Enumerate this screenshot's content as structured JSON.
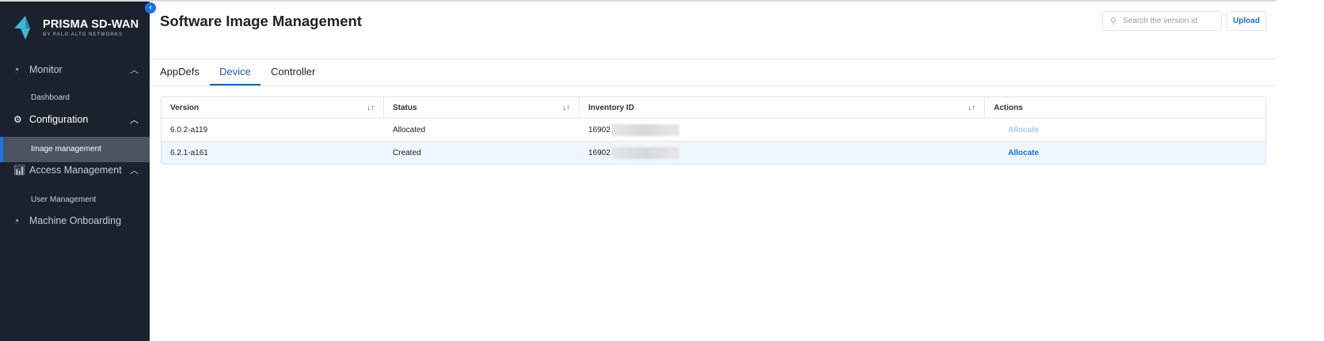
{
  "sidebar": {
    "logo": {
      "title": "PRISMA SD-WAN",
      "subtitle": "BY PALO ALTO NETWORKS"
    },
    "sections": [
      {
        "label": "Monitor",
        "icon": "dashboard-gauge-icon",
        "items": [
          {
            "label": "Dashboard"
          }
        ]
      },
      {
        "label": "Configuration",
        "icon": "gear-icon",
        "items": [
          {
            "label": "Image management",
            "active": true
          }
        ]
      },
      {
        "label": "Access Management",
        "icon": "bar-chart-icon",
        "items": [
          {
            "label": "User Management"
          }
        ]
      },
      {
        "label": "Machine Onboarding",
        "icon": "dashboard-gauge-icon",
        "items": []
      }
    ]
  },
  "header": {
    "title": "Software Image Management",
    "search_placeholder": "Search the version id",
    "upload_label": "Upload"
  },
  "tabs": [
    {
      "label": "AppDefs"
    },
    {
      "label": "Device",
      "active": true
    },
    {
      "label": "Controller"
    }
  ],
  "table": {
    "columns": [
      "Version",
      "Status",
      "Inventory ID",
      "Actions"
    ],
    "rows": [
      {
        "version": "6.0.2-a119",
        "status": "Allocated",
        "inventory_id": "16902",
        "action": "Allocate",
        "action_enabled": false
      },
      {
        "version": "6.2.1-a161",
        "status": "Created",
        "inventory_id": "16902",
        "action": "Allocate",
        "action_enabled": true
      }
    ]
  },
  "colors": {
    "sidebar_bg": "#1c222d",
    "accent": "#1a73e8",
    "selected_row": "#eef6ff"
  }
}
